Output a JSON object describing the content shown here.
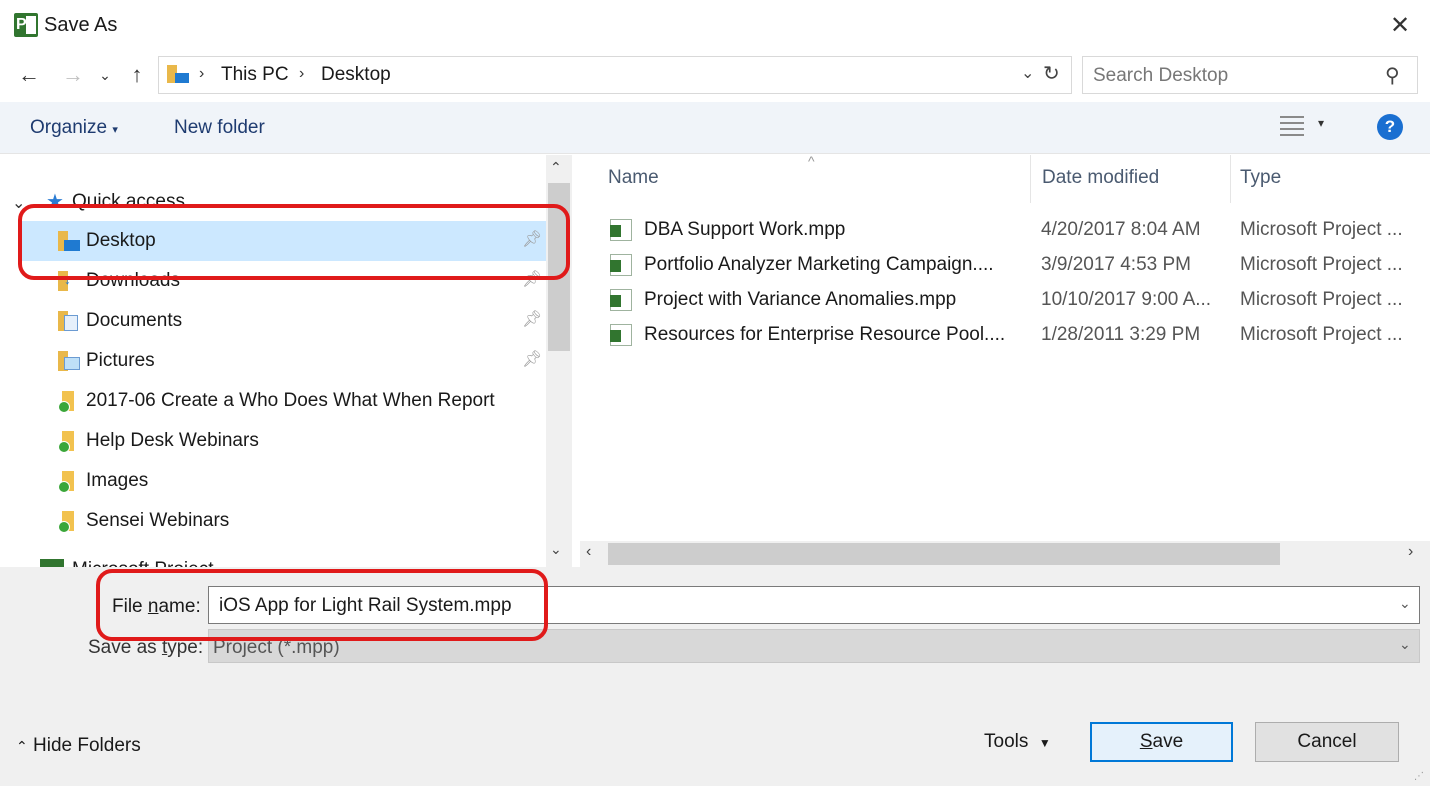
{
  "window": {
    "title": "Save As"
  },
  "nav": {
    "breadcrumb": [
      "This PC",
      "Desktop"
    ],
    "search_placeholder": "Search Desktop"
  },
  "commands": {
    "organize": "Organize",
    "new_folder": "New folder"
  },
  "navpane": {
    "quick_access": "Quick access",
    "items": [
      {
        "label": "Desktop",
        "icon": "desktop-folder-icon",
        "pinned": true,
        "selected": true
      },
      {
        "label": "Downloads",
        "icon": "downloads-folder-icon",
        "pinned": true
      },
      {
        "label": "Documents",
        "icon": "documents-folder-icon",
        "pinned": true
      },
      {
        "label": "Pictures",
        "icon": "pictures-folder-icon",
        "pinned": true
      },
      {
        "label": "2017-06 Create a Who Does What When Report",
        "icon": "synced-folder-icon"
      },
      {
        "label": "Help Desk Webinars",
        "icon": "synced-folder-icon"
      },
      {
        "label": "Images",
        "icon": "synced-folder-icon"
      },
      {
        "label": "Sensei Webinars",
        "icon": "synced-folder-icon"
      }
    ],
    "partial_item": "Microsoft Project"
  },
  "filelist": {
    "columns": {
      "name": "Name",
      "date": "Date modified",
      "type": "Type"
    },
    "rows": [
      {
        "name": "DBA Support Work.mpp",
        "date": "4/20/2017 8:04 AM",
        "type": "Microsoft Project ..."
      },
      {
        "name": "Portfolio Analyzer Marketing Campaign....",
        "date": "3/9/2017 4:53 PM",
        "type": "Microsoft Project ..."
      },
      {
        "name": "Project with Variance Anomalies.mpp",
        "date": "10/10/2017 9:00 A...",
        "type": "Microsoft Project ..."
      },
      {
        "name": "Resources for Enterprise Resource Pool....",
        "date": "1/28/2011 3:29 PM",
        "type": "Microsoft Project ..."
      }
    ]
  },
  "form": {
    "file_name_label_pre": "File ",
    "file_name_label_u": "n",
    "file_name_label_post": "ame:",
    "file_name_value": "iOS App for Light Rail System.mpp",
    "save_type_label_pre": "Save as ",
    "save_type_label_u": "t",
    "save_type_label_post": "ype:",
    "save_type_value": "Project (*.mpp)"
  },
  "footer": {
    "hide_folders": "Hide Folders",
    "tools": "Tools",
    "save_u": "S",
    "save_rest": "ave",
    "cancel": "Cancel"
  },
  "colors": {
    "accent": "#0078d7",
    "selection": "#cce8ff",
    "annotation": "#e01a1a"
  }
}
